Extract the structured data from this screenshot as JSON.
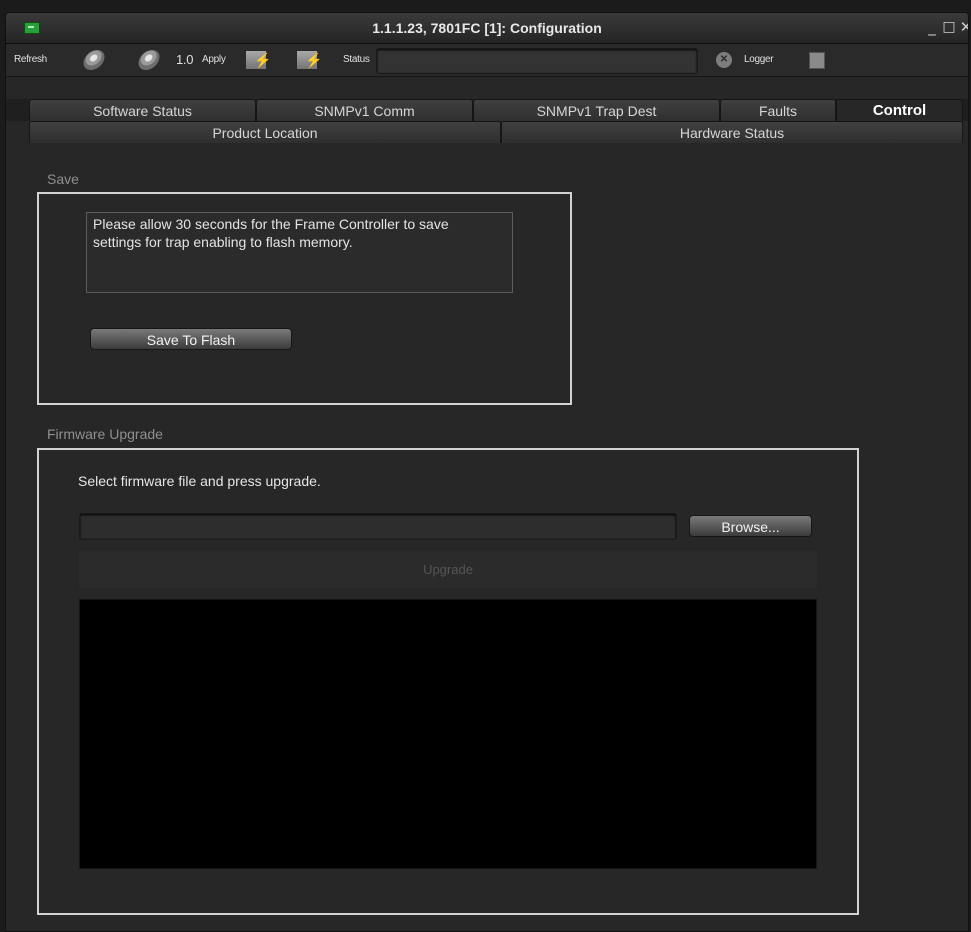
{
  "window": {
    "title": "1.1.1.23, 7801FC  [1]: Configuration",
    "min_glyph": "_",
    "max_glyph": "□",
    "close_glyph": "✕"
  },
  "toolbar": {
    "refresh_label": "Refresh",
    "version_label": "1.0",
    "apply_label": "Apply",
    "status_label": "Status",
    "status_value": "",
    "logger_label": "Logger",
    "icons": [
      "refresh-gear-icon",
      "refresh-gear-icon",
      "flash-icon",
      "flash-icon",
      "close-circle-icon",
      "logger-icon"
    ]
  },
  "tabs": {
    "row1": [
      "Software Status",
      "SNMPv1 Comm",
      "SNMPv1 Trap Dest",
      "Faults",
      "Control"
    ],
    "row2": [
      "Product Location",
      "Hardware Status"
    ],
    "active": "Control"
  },
  "save_section": {
    "title": "Save",
    "message": "Please allow 30 seconds for the Frame Controller to save\nsettings for trap enabling to flash memory.",
    "button_label": "Save To Flash"
  },
  "firmware_section": {
    "title": "Firmware Upgrade",
    "instruction": "Select firmware file and press upgrade.",
    "file_path": "",
    "browse_label": "Browse...",
    "upgrade_label": "Upgrade",
    "log_output": ""
  },
  "colors": {
    "background": "#272727",
    "group_border": "#d2d2d2",
    "log_background": "#000000"
  }
}
